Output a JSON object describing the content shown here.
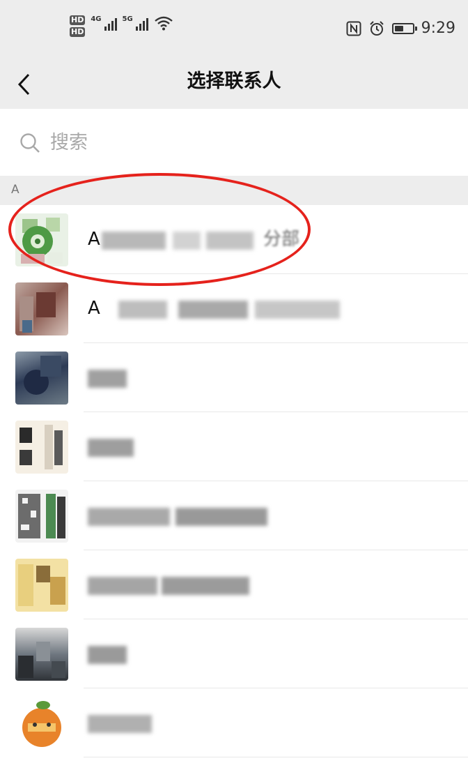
{
  "status_bar": {
    "hd_badge_1": "HD",
    "hd_badge_2": "HD",
    "network_1": "4G",
    "network_2": "5G",
    "battery_level": 0.5,
    "time": "9:29"
  },
  "nav": {
    "title": "选择联系人",
    "back_icon": "chevron-left-icon"
  },
  "search": {
    "placeholder": "搜索",
    "icon": "search-icon"
  },
  "section_header": "A",
  "contacts": [
    {
      "name_visible": "A",
      "name_tail": "分部",
      "highlighted": true
    },
    {
      "name_visible": "A"
    },
    {},
    {},
    {},
    {},
    {},
    {}
  ],
  "colors": {
    "header_bg": "#ededed",
    "annotation_red": "#e5221c",
    "placeholder_gray": "#a8a8a8"
  }
}
